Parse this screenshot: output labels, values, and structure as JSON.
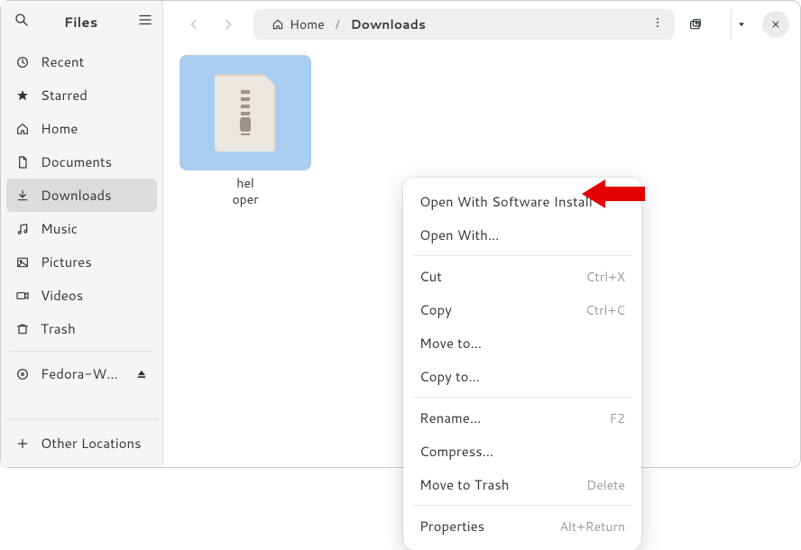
{
  "sidebar": {
    "title": "Files",
    "items": [
      {
        "label": "Recent"
      },
      {
        "label": "Starred"
      },
      {
        "label": "Home"
      },
      {
        "label": "Documents"
      },
      {
        "label": "Downloads"
      },
      {
        "label": "Music"
      },
      {
        "label": "Pictures"
      },
      {
        "label": "Videos"
      },
      {
        "label": "Trash"
      }
    ],
    "volume": {
      "label": "Fedora-W…"
    },
    "other": {
      "label": "Other Locations"
    }
  },
  "pathbar": {
    "home": "Home",
    "current": "Downloads"
  },
  "file": {
    "line1": "hel",
    "line2": "oper"
  },
  "menu": {
    "open_with_app": "Open With Software Install",
    "open_with": "Open With…",
    "cut": {
      "label": "Cut",
      "accel": "Ctrl+X"
    },
    "copy": {
      "label": "Copy",
      "accel": "Ctrl+C"
    },
    "move_to": "Move to…",
    "copy_to": "Copy to…",
    "rename": {
      "label": "Rename…",
      "accel": "F2"
    },
    "compress": "Compress…",
    "trash": {
      "label": "Move to Trash",
      "accel": "Delete"
    },
    "properties": {
      "label": "Properties",
      "accel": "Alt+Return"
    }
  }
}
